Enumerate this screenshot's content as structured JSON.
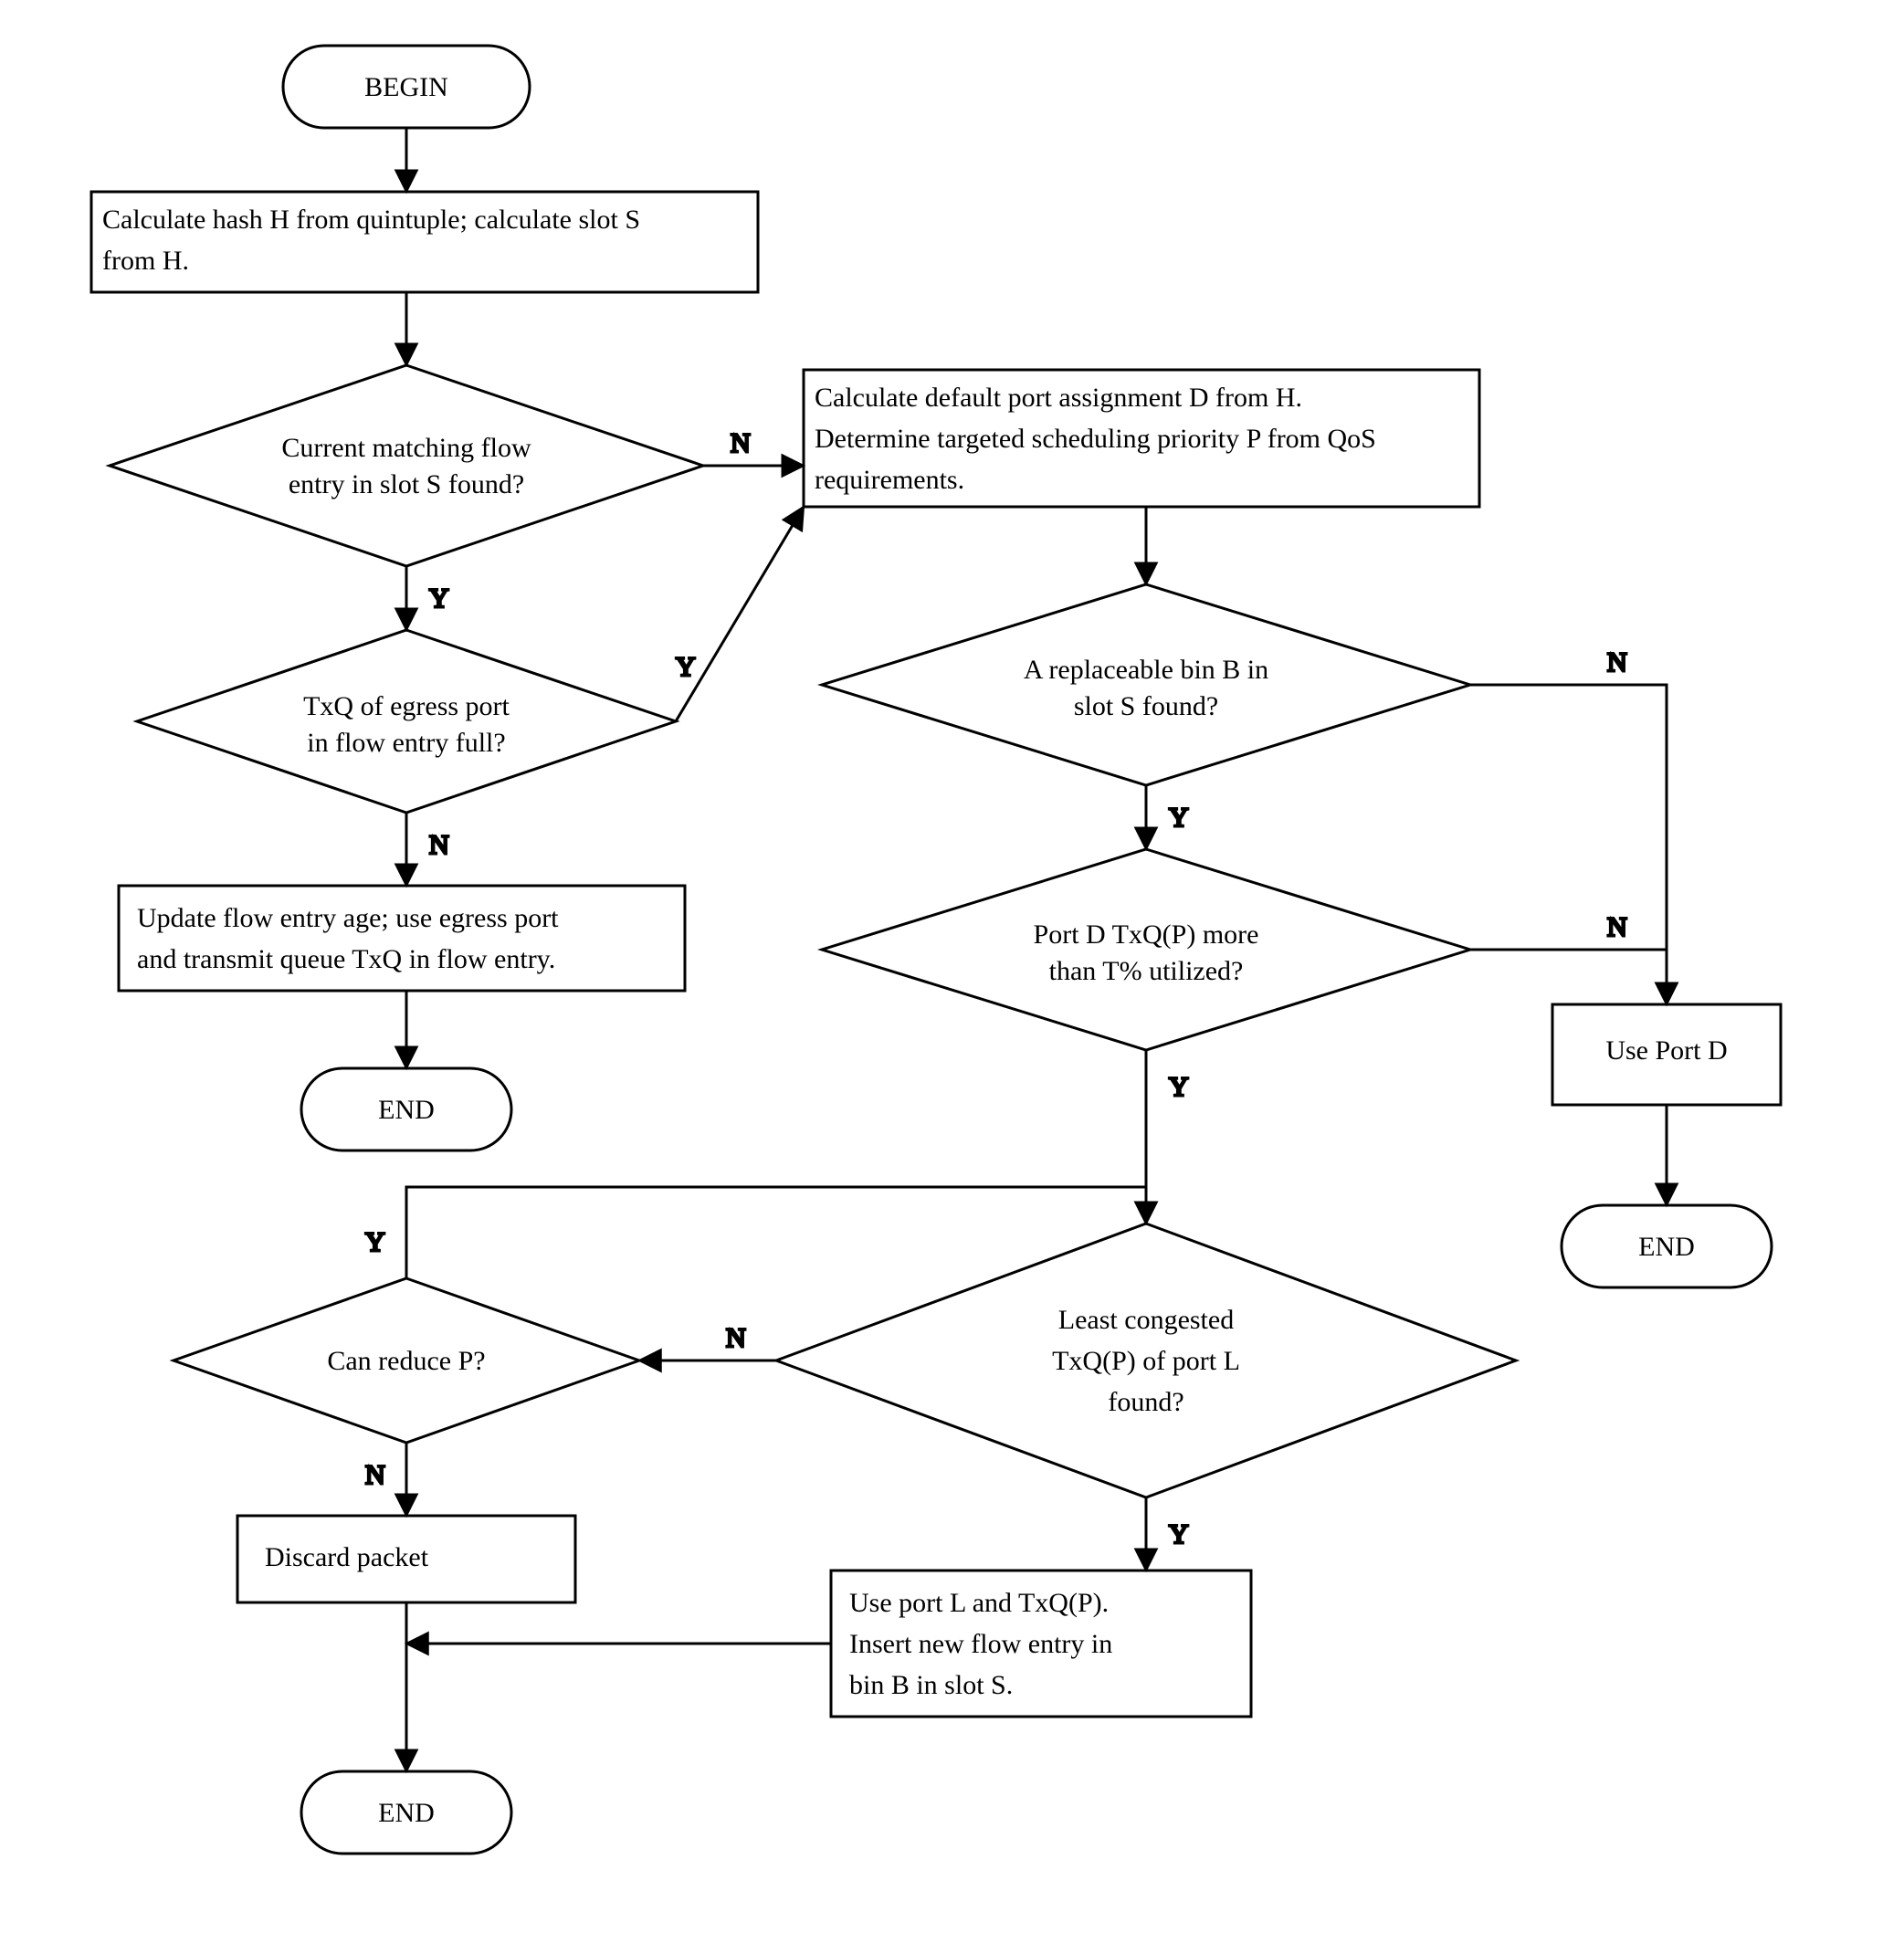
{
  "nodes": {
    "begin": {
      "label": "BEGIN"
    },
    "hash": {
      "line1": "Calculate hash H from quintuple; calculate slot S",
      "line2": "from H."
    },
    "match": {
      "line1": "Current matching flow",
      "line2": "entry in slot S found?"
    },
    "txq_full": {
      "line1": "TxQ of egress port",
      "line2": "in flow entry full?"
    },
    "update": {
      "line1": "Update flow entry age; use egress port",
      "line2": "and transmit queue TxQ in flow entry."
    },
    "end1": {
      "label": "END"
    },
    "calc_default": {
      "line1": "Calculate default port assignment D from H.",
      "line2": "Determine targeted scheduling priority P from QoS",
      "line3": "requirements."
    },
    "bin": {
      "line1": "A replaceable bin B in",
      "line2": "slot S found?"
    },
    "portd_util": {
      "line1": "Port D TxQ(P) more",
      "line2": "than T% utilized?"
    },
    "use_portd": {
      "label": "Use Port D"
    },
    "end2": {
      "label": "END"
    },
    "least": {
      "line1": "Least congested",
      "line2": "TxQ(P) of port L",
      "line3": "found?"
    },
    "reduce": {
      "label": "Can reduce P?"
    },
    "discard": {
      "label": "Discard packet"
    },
    "use_portl": {
      "line1": "Use port L and TxQ(P).",
      "line2": "Insert new flow entry in",
      "line3": "bin B in slot S."
    },
    "end3": {
      "label": "END"
    }
  },
  "labels": {
    "Y": "Y",
    "N": "N"
  }
}
